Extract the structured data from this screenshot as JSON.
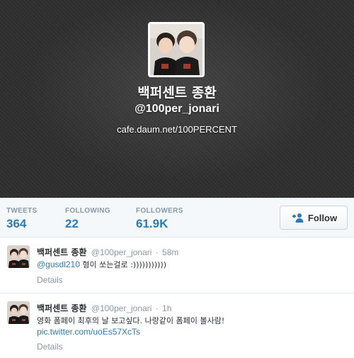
{
  "profile": {
    "name": "백퍼센트 종환",
    "handle": "@100per_jonari",
    "url": "cafe.daum.net/100PERCENT"
  },
  "stats": [
    {
      "label": "TWEETS",
      "value": "364"
    },
    {
      "label": "FOLLOWING",
      "value": "22"
    },
    {
      "label": "FOLLOWERS",
      "value": "61.9K"
    }
  ],
  "follow_button": {
    "label": "Follow",
    "icon": "add-user-icon"
  },
  "tweets": [
    {
      "name": "백퍼센트 종환",
      "handle": "@100per_jonari",
      "separator": "·",
      "time": "58m",
      "mention": "@gusdl210",
      "text": " 형이 쏘는걸로 :)))))))))))",
      "details_label": "Details"
    },
    {
      "name": "백퍼센트 종환",
      "handle": "@100per_jonari",
      "separator": "·",
      "time": "1h",
      "text": "영화 폼페이 최후의 날 보고싶다. 나랑같이 폼페이 볼사람!",
      "link": "pic.twitter.com/uoEs57XcTs",
      "details_label": "Details"
    }
  ],
  "colors": {
    "header_bg": "#2f2f2f",
    "link": "#2b7bb9",
    "muted": "#8899a6",
    "stats_bg": "#f5f8fa"
  }
}
